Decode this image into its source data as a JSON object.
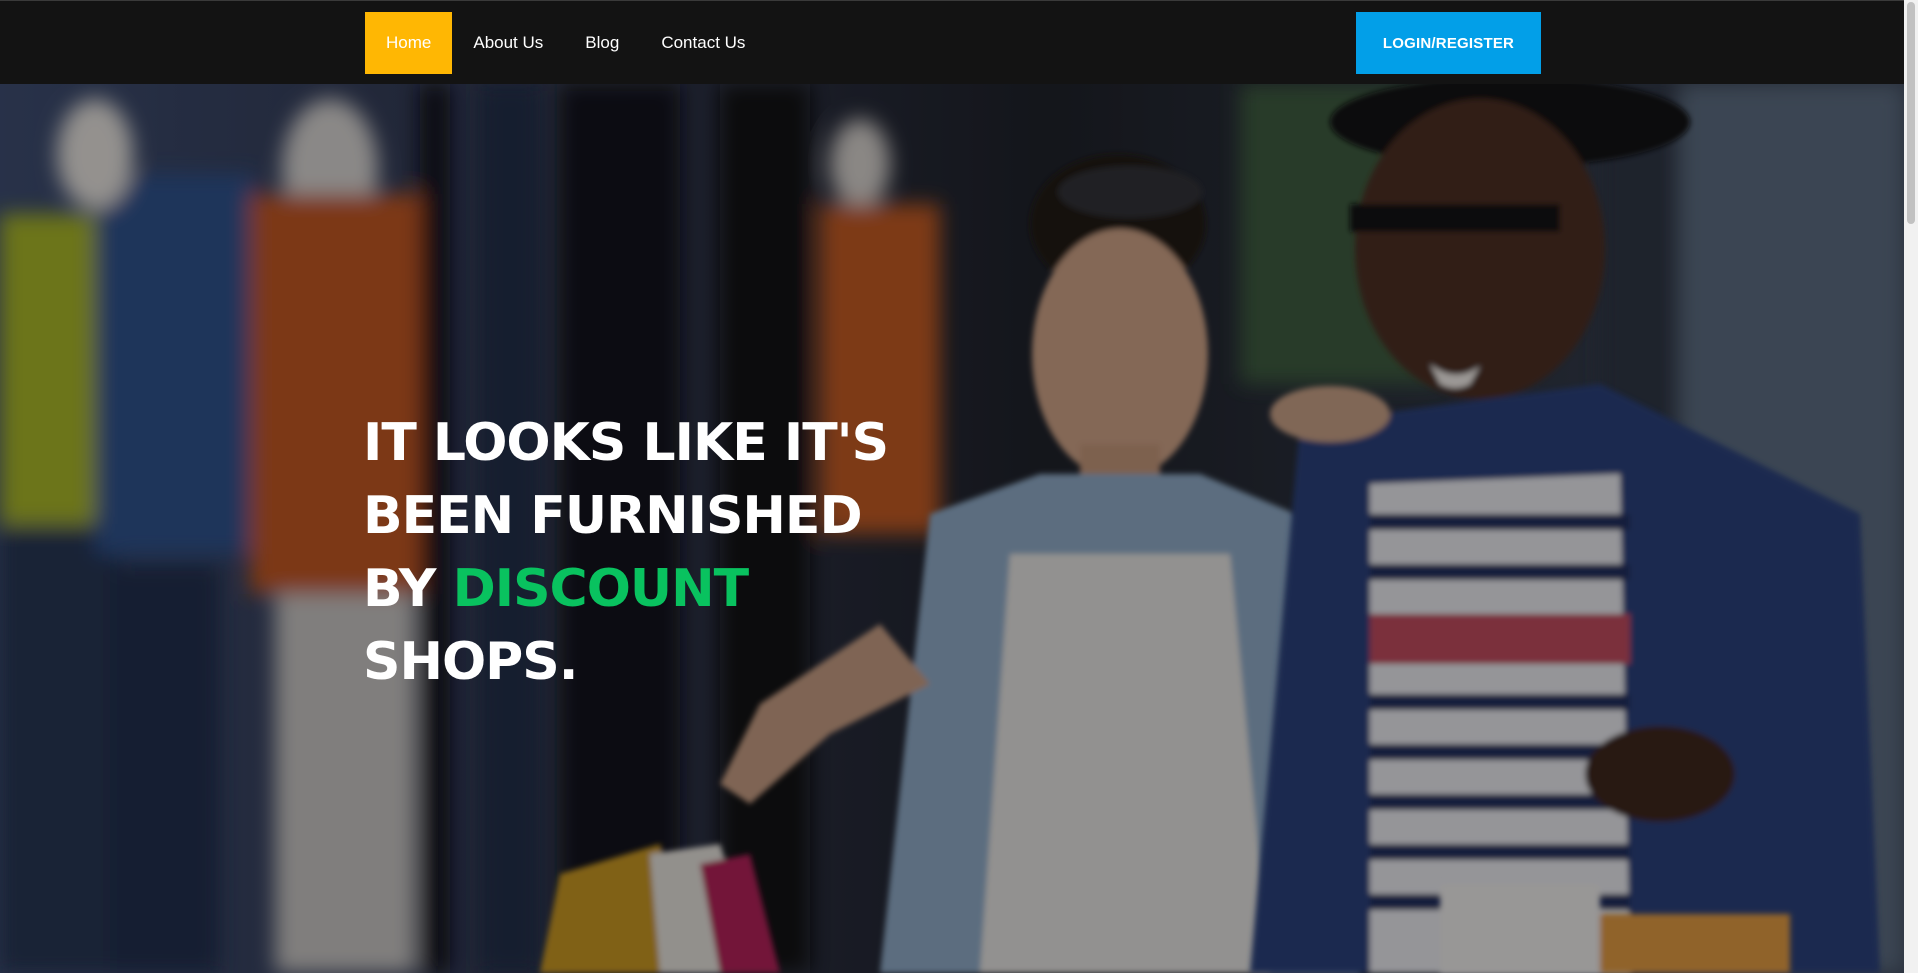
{
  "nav": {
    "items": [
      {
        "label": "Home",
        "active": true
      },
      {
        "label": "About Us",
        "active": false
      },
      {
        "label": "Blog",
        "active": false
      },
      {
        "label": "Contact Us",
        "active": false
      }
    ],
    "login_label": "LOGIN/REGISTER"
  },
  "hero": {
    "line1": "IT LOOKS LIKE IT'S",
    "line2": "BEEN FURNISHED",
    "line3_prefix": "BY ",
    "line3_accent": "DISCOUNT",
    "line4": "SHOPS."
  },
  "colors": {
    "nav_bg": "#131313",
    "active_nav": "#ffb703",
    "login_button": "#029fe8",
    "accent_text": "#09c25f",
    "text": "#ffffff"
  }
}
